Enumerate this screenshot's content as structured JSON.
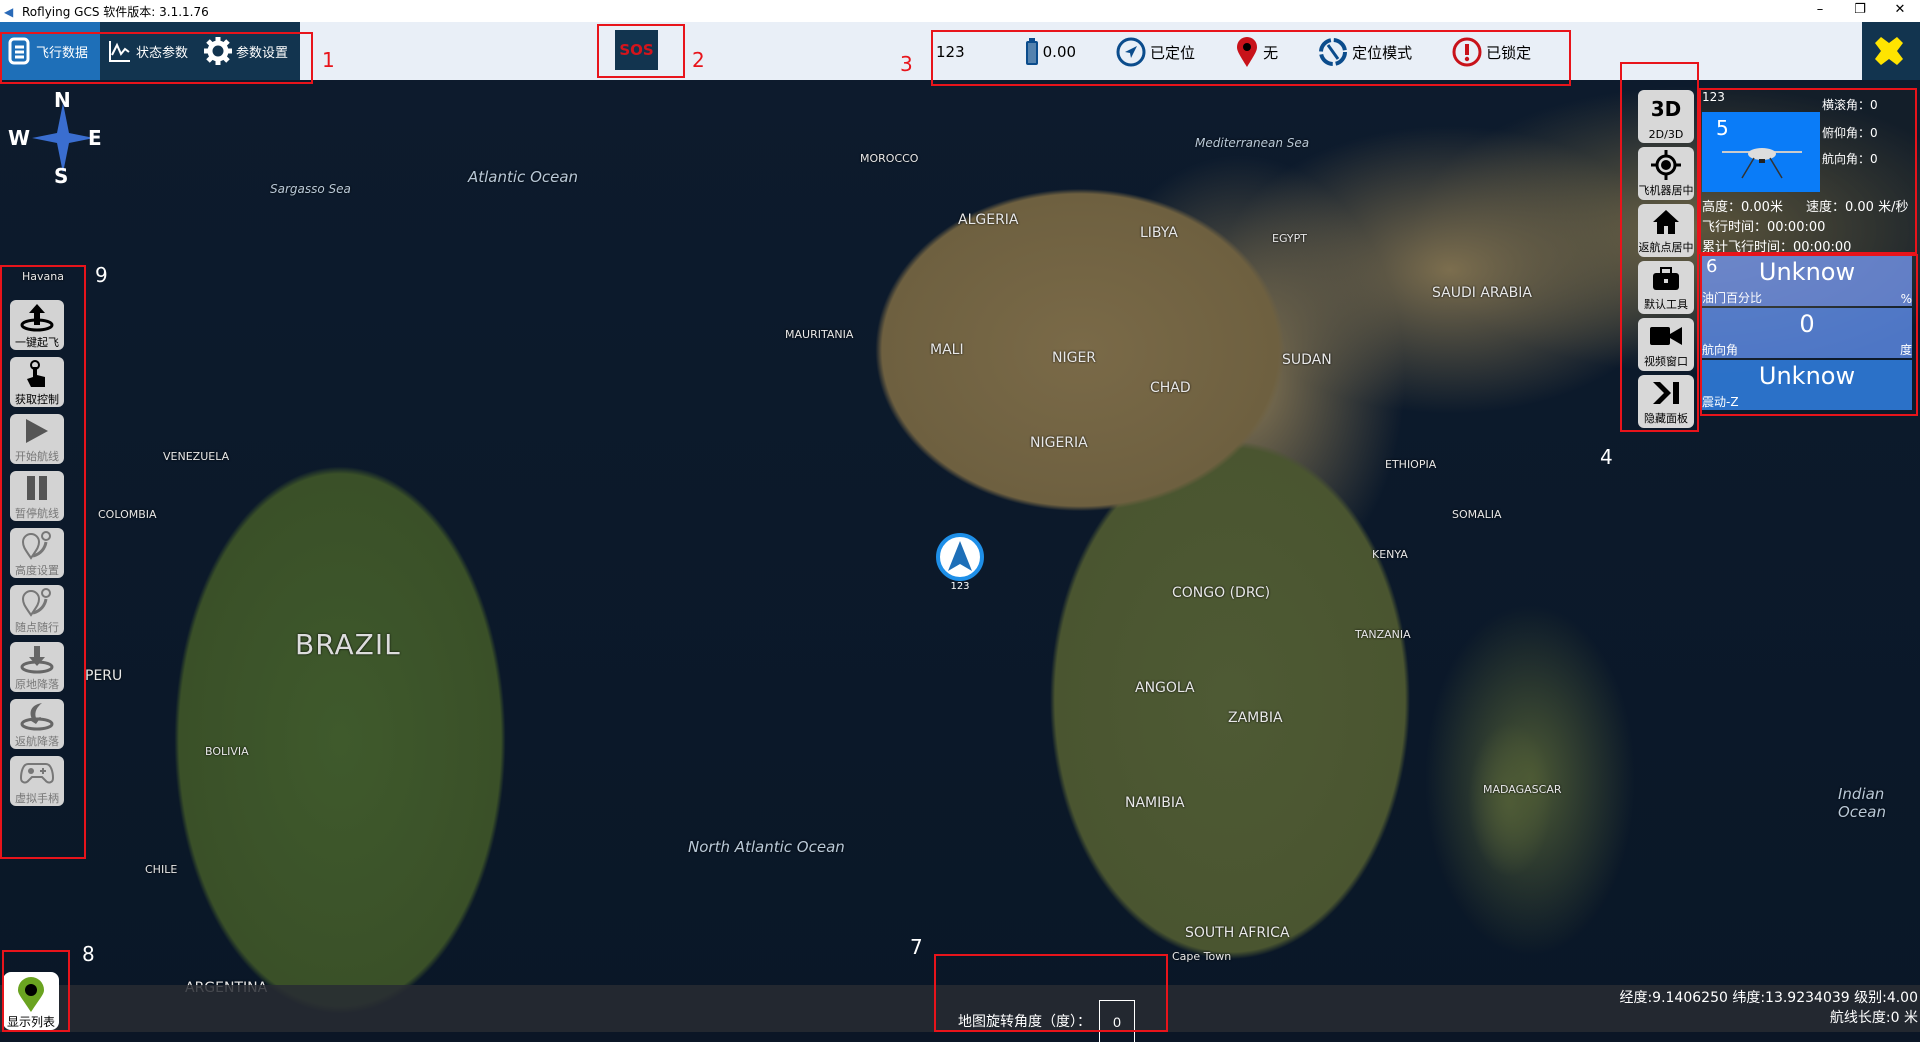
{
  "window": {
    "title": "Roflying GCS 软件版本: 3.1.1.76",
    "minimize": "–",
    "maximize": "❐",
    "close": "✕"
  },
  "tabs": [
    {
      "label": "飞行数据",
      "icon": "document-icon"
    },
    {
      "label": "状态参数",
      "icon": "chart-line-icon"
    },
    {
      "label": "参数设置",
      "icon": "gear-icon"
    }
  ],
  "sos": {
    "label": "SOS"
  },
  "status": {
    "vehicle_id": "123",
    "battery": "0.00",
    "gps": "已定位",
    "waypoint": "无",
    "mode": "定位模式",
    "lock": "已锁定"
  },
  "colors": {
    "accent": "#1e6fb8",
    "navy": "#12344f",
    "red": "#e8141b",
    "blue_panel": "#0a7cf8"
  },
  "region_numbers": [
    "1",
    "2",
    "3",
    "4",
    "5",
    "6",
    "7",
    "8",
    "9"
  ],
  "right_buttons": [
    {
      "icon_text": "3D",
      "label": "2D/3D"
    },
    {
      "label": "飞机器居中"
    },
    {
      "label": "返航点居中"
    },
    {
      "label": "默认工具"
    },
    {
      "label": "视频窗口"
    },
    {
      "label": "隐藏面板"
    }
  ],
  "left_buttons": [
    {
      "label": "一键起飞"
    },
    {
      "label": "获取控制"
    },
    {
      "label": "开始航线"
    },
    {
      "label": "暂停航线"
    },
    {
      "label": "高度设置"
    },
    {
      "label": "随点随行"
    },
    {
      "label": "原地降落"
    },
    {
      "label": "返航降落"
    },
    {
      "label": "虚拟手柄"
    }
  ],
  "flight_panel": {
    "vehicle": "123",
    "roll": "横滚角：0",
    "pitch": "俯仰角：0",
    "heading": "航向角：0",
    "altitude": "高度：0.00米",
    "speed": "速度：0.00 米/秒",
    "flight_time": "飞行时间：00:00:00",
    "total_time": "累计飞行时间：00:00:00"
  },
  "gauges": [
    {
      "value": "Unknow",
      "label": "油门百分比",
      "unit": "%",
      "bg": "#6f8ee0"
    },
    {
      "value": "0",
      "label": "航向角",
      "unit": "度",
      "bg": "#5b87e0"
    },
    {
      "value": "Unknow",
      "label": "震动-Z",
      "unit": "",
      "bg": "#2f78d6"
    }
  ],
  "compass": {
    "n": "N",
    "s": "S",
    "e": "E",
    "w": "W"
  },
  "map_labels": [
    "Atlantic Ocean",
    "Sargasso Sea",
    "North Atlantic Ocean",
    "Indian Ocean",
    "Mediterranean Sea",
    "BRAZIL",
    "ALGERIA",
    "LIBYA",
    "EGYPT",
    "MALI",
    "NIGER",
    "CHAD",
    "SUDAN",
    "NIGERIA",
    "CONGO (DRC)",
    "ANGOLA",
    "ZAMBIA",
    "NAMIBIA",
    "SOUTH AFRICA",
    "TANZANIA",
    "KENYA",
    "ETHIOPIA",
    "SOMALIA",
    "SAUDI ARABIA",
    "MOROCCO",
    "MAURITANIA",
    "PERU",
    "BOLIVIA",
    "COLOMBIA",
    "VENEZUELA",
    "CHILE",
    "ARGENTINA",
    "MADAGASCAR",
    "Havana",
    "Cape Town"
  ],
  "aircraft": {
    "label": "123"
  },
  "bottom": {
    "rotation_label": "地图旋转角度（度）：",
    "rotation_value": "0",
    "coords": "经度:9.1406250 纬度:13.9234039 级别:4.00",
    "route_length": "航线长度:0 米"
  },
  "show_list": {
    "label": "显示列表"
  }
}
